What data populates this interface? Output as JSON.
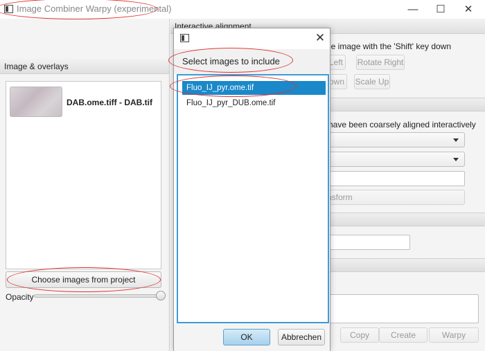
{
  "window": {
    "title": "Image Combiner Warpy (experimental)",
    "controls": {
      "minimize": "—",
      "maximize": "☐",
      "close": "✕"
    }
  },
  "left_panel": {
    "header": "Image & overlays",
    "items": [
      {
        "label": "DAB.ome.tiff - DAB.tif"
      }
    ],
    "choose_button": "Choose images from project",
    "opacity_label": "Opacity",
    "opacity_value": 1.0
  },
  "right_panel": {
    "section_title": "Interactive alignment",
    "instruction_text": "he image with the 'Shift' key down",
    "buttons": {
      "left": "Left",
      "rotate_right": "Rotate Right",
      "down": "own",
      "scale_up": "Scale Up",
      "transform": "nsform"
    },
    "auto_text": "have been coarsely aligned interactively",
    "bottom_buttons": {
      "copy": "Copy",
      "create": "Create",
      "warpy": "Warpy"
    }
  },
  "dialog": {
    "heading": "Select images to include",
    "images": [
      {
        "name": "Fluo_IJ_pyr.ome.tif",
        "selected": true
      },
      {
        "name": "Fluo_IJ_pyr_DUB.ome.tif",
        "selected": false
      }
    ],
    "ok_label": "OK",
    "cancel_label": "Abbrechen",
    "close_glyph": "✕"
  },
  "colors": {
    "selection": "#1a88c9",
    "focus_border": "#3c9bd6",
    "annotation": "#e03030"
  }
}
